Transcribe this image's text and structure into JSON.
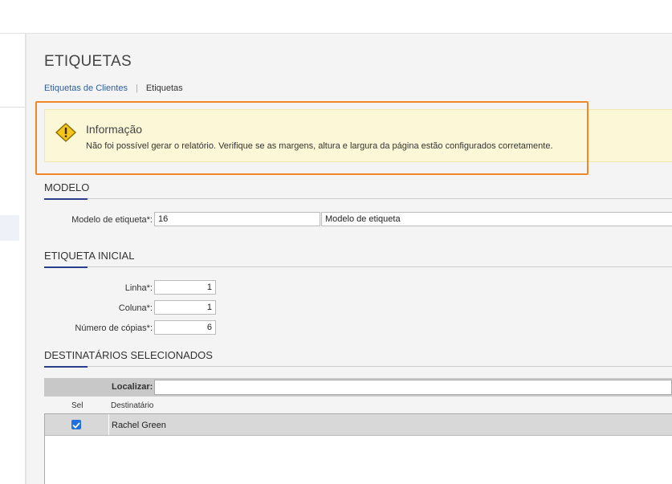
{
  "page": {
    "title": "ETIQUETAS",
    "breadcrumb": {
      "parent": "Etiquetas de Clientes",
      "current": "Etiquetas"
    }
  },
  "alert": {
    "title": "Informação",
    "message": "Não foi possível gerar o relatório. Verifique se as margens, altura e largura da página estão configurados corretamente."
  },
  "modelo": {
    "section_title": "MODELO",
    "label": "Modelo de etiqueta*:",
    "code": "16",
    "description": "Modelo de etiqueta"
  },
  "etiqueta_inicial": {
    "section_title": "ETIQUETA INICIAL",
    "linha_label": "Linha*:",
    "linha_value": "1",
    "coluna_label": "Coluna*:",
    "coluna_value": "1",
    "copias_label": "Número de cópias*:",
    "copias_value": "6"
  },
  "destinatarios": {
    "section_title": "DESTINATÁRIOS SELECIONADOS",
    "search_label": "Localizar:",
    "search_value": "",
    "columns": [
      "Sel",
      "Destinatário"
    ],
    "rows": [
      {
        "selected": true,
        "name": "Rachel Green"
      }
    ]
  },
  "colors": {
    "accent": "#2a3f8c",
    "highlight": "#f0882a",
    "info_bg": "#fcf8d7",
    "link": "#2d5f9a"
  }
}
